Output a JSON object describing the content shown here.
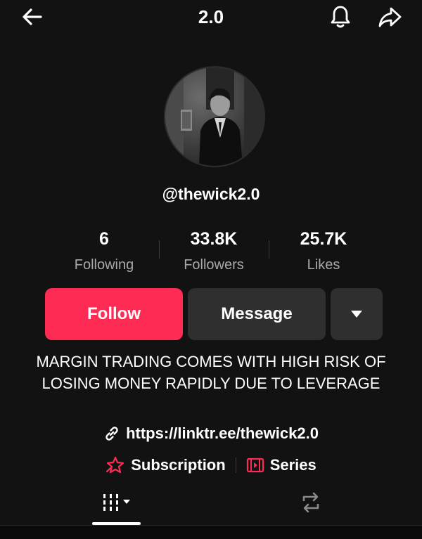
{
  "header": {
    "title": "2.0"
  },
  "profile": {
    "handle": "@thewick2.0",
    "avatar_desc": "avatar-photo"
  },
  "stats": [
    {
      "value": "6",
      "label": "Following"
    },
    {
      "value": "33.8K",
      "label": "Followers"
    },
    {
      "value": "25.7K",
      "label": "Likes"
    }
  ],
  "actions": {
    "follow_label": "Follow",
    "message_label": "Message"
  },
  "bio": "MARGIN TRADING COMES WITH HIGH RISK OF LOSING MONEY RAPIDLY DUE TO LEVERAGE",
  "link": "https://linktr.ee/thewick2.0",
  "extras": {
    "subscription": "Subscription",
    "series": "Series"
  },
  "colors": {
    "accent": "#fe2c55",
    "background": "#121212",
    "button_secondary": "#2f2f2f",
    "muted_text": "#a9a9a9"
  },
  "icons": {
    "back": "arrow-left-icon",
    "bell": "bell-icon",
    "share": "share-arrow-icon",
    "dropdown": "caret-down-icon",
    "link": "link-icon",
    "subscription": "subscription-star-icon",
    "series": "series-film-icon",
    "videos_tab": "grid-columns-icon",
    "reposts_tab": "repost-icon"
  }
}
